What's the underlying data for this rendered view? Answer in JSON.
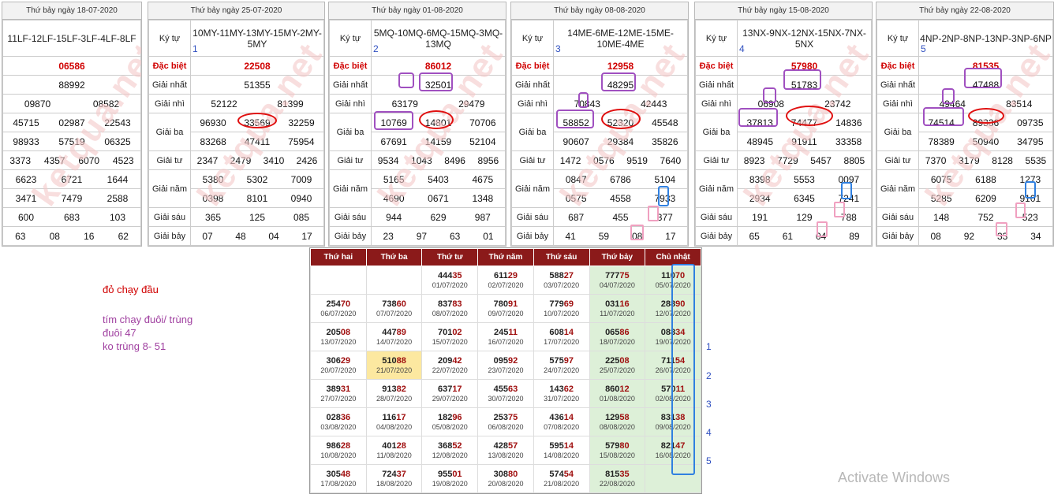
{
  "row_labels": {
    "kytu": "Ký tự",
    "db": "Đặc biệt",
    "g1": "Giải nhất",
    "g2": "Giải nhì",
    "g3": "Giải ba",
    "g4": "Giải tư",
    "g5": "Giải năm",
    "g6": "Giải sáu",
    "g7": "Giải bảy"
  },
  "watermark": "ketqua.net",
  "panels": [
    {
      "title": "Thứ bảy ngày 18-07-2020",
      "index": "",
      "kytu": "11LF-12LF-15LF-3LF-4LF-8LF",
      "db": "06586",
      "g1": "88992",
      "g2": [
        "09870",
        "08582"
      ],
      "g3": [
        "45715",
        "02987",
        "22543",
        "98933",
        "57519",
        "06325"
      ],
      "g4": [
        "3373",
        "4357",
        "6070",
        "4523"
      ],
      "g5": [
        "6623",
        "6721",
        "1644",
        "3471",
        "7479",
        "2588"
      ],
      "g6": [
        "600",
        "683",
        "103"
      ],
      "g7": [
        "63",
        "08",
        "16",
        "62"
      ]
    },
    {
      "title": "Thứ bảy ngày 25-07-2020",
      "index": "1",
      "kytu": "10MY-11MY-13MY-15MY-2MY-5MY",
      "db": "22508",
      "g1": "51355",
      "g2": [
        "52122",
        "81399"
      ],
      "g3": [
        "96930",
        "33569",
        "32259",
        "83268",
        "47411",
        "75954"
      ],
      "g4": [
        "2347",
        "2479",
        "3410",
        "2426"
      ],
      "g5": [
        "5380",
        "5302",
        "7009",
        "0398",
        "8101",
        "0940"
      ],
      "g6": [
        "365",
        "125",
        "085"
      ],
      "g7": [
        "07",
        "48",
        "04",
        "17"
      ]
    },
    {
      "title": "Thứ bảy ngày 01-08-2020",
      "index": "2",
      "kytu": "5MQ-10MQ-6MQ-15MQ-3MQ-13MQ",
      "db": "86012",
      "g1": "32501",
      "g2": [
        "63179",
        "29479"
      ],
      "g3": [
        "10769",
        "14801",
        "70706",
        "67691",
        "14159",
        "52104"
      ],
      "g4": [
        "9534",
        "1043",
        "8496",
        "8956"
      ],
      "g5": [
        "5165",
        "5403",
        "4675",
        "4690",
        "0671",
        "1348"
      ],
      "g6": [
        "944",
        "629",
        "987"
      ],
      "g7": [
        "23",
        "97",
        "63",
        "01"
      ]
    },
    {
      "title": "Thứ bảy ngày 08-08-2020",
      "index": "3",
      "kytu": "14ME-6ME-12ME-15ME-10ME-4ME",
      "db": "12958",
      "g1": "48295",
      "g2": [
        "70843",
        "42443"
      ],
      "g3": [
        "58852",
        "52320",
        "45548",
        "90607",
        "29384",
        "35826"
      ],
      "g4": [
        "1472",
        "0576",
        "9519",
        "7640"
      ],
      "g5": [
        "0847",
        "6786",
        "5104",
        "0575",
        "4558",
        "7933"
      ],
      "g6": [
        "687",
        "455",
        "377"
      ],
      "g7": [
        "41",
        "59",
        "08",
        "17"
      ]
    },
    {
      "title": "Thứ bảy ngày 15-08-2020",
      "index": "4",
      "kytu": "13NX-9NX-12NX-15NX-7NX-5NX",
      "db": "57980",
      "g1": "51783",
      "g2": [
        "06908",
        "23742"
      ],
      "g3": [
        "37813",
        "74477",
        "14836",
        "48945",
        "91911",
        "33358"
      ],
      "g4": [
        "8923",
        "7729",
        "5457",
        "8805"
      ],
      "g5": [
        "8398",
        "5553",
        "0097",
        "2934",
        "6345",
        "7241"
      ],
      "g6": [
        "191",
        "129",
        "788"
      ],
      "g7": [
        "65",
        "61",
        "04",
        "89"
      ]
    },
    {
      "title": "Thứ bảy ngày 22-08-2020",
      "index": "5",
      "kytu": "4NP-2NP-8NP-13NP-3NP-6NP",
      "db": "81535",
      "g1": "47488",
      "g2": [
        "49464",
        "83514"
      ],
      "g3": [
        "74514",
        "89336",
        "09735",
        "78389",
        "50940",
        "34795"
      ],
      "g4": [
        "7370",
        "3179",
        "8128",
        "5535"
      ],
      "g5": [
        "6075",
        "6188",
        "1273",
        "5285",
        "6209",
        "9101"
      ],
      "g6": [
        "148",
        "752",
        "523"
      ],
      "g7": [
        "08",
        "92",
        "33",
        "34"
      ]
    }
  ],
  "calendar": {
    "headers": [
      "Thứ hai",
      "Thứ ba",
      "Thứ tư",
      "Thứ năm",
      "Thứ sáu",
      "Thứ bảy",
      "Chủ nhật"
    ],
    "rows": [
      [
        {
          "n": "",
          "d": ""
        },
        {
          "n": "",
          "d": ""
        },
        {
          "n": "44435",
          "d": "01/07/2020"
        },
        {
          "n": "61129",
          "d": "02/07/2020"
        },
        {
          "n": "58827",
          "d": "03/07/2020"
        },
        {
          "n": "77775",
          "d": "04/07/2020"
        },
        {
          "n": "11070",
          "d": "05/07/2020"
        }
      ],
      [
        {
          "n": "25470",
          "d": "06/07/2020"
        },
        {
          "n": "73860",
          "d": "07/07/2020"
        },
        {
          "n": "83783",
          "d": "08/07/2020"
        },
        {
          "n": "78091",
          "d": "09/07/2020"
        },
        {
          "n": "77969",
          "d": "10/07/2020"
        },
        {
          "n": "03116",
          "d": "11/07/2020"
        },
        {
          "n": "28890",
          "d": "12/07/2020"
        }
      ],
      [
        {
          "n": "20508",
          "d": "13/07/2020"
        },
        {
          "n": "44789",
          "d": "14/07/2020"
        },
        {
          "n": "70102",
          "d": "15/07/2020"
        },
        {
          "n": "24511",
          "d": "16/07/2020"
        },
        {
          "n": "60814",
          "d": "17/07/2020"
        },
        {
          "n": "06586",
          "d": "18/07/2020"
        },
        {
          "n": "08834",
          "d": "19/07/2020"
        }
      ],
      [
        {
          "n": "30629",
          "d": "20/07/2020"
        },
        {
          "n": "51088",
          "d": "21/07/2020"
        },
        {
          "n": "20942",
          "d": "22/07/2020"
        },
        {
          "n": "09592",
          "d": "23/07/2020"
        },
        {
          "n": "57597",
          "d": "24/07/2020"
        },
        {
          "n": "22508",
          "d": "25/07/2020"
        },
        {
          "n": "71154",
          "d": "26/07/2020"
        }
      ],
      [
        {
          "n": "38931",
          "d": "27/07/2020"
        },
        {
          "n": "91382",
          "d": "28/07/2020"
        },
        {
          "n": "63717",
          "d": "29/07/2020"
        },
        {
          "n": "45563",
          "d": "30/07/2020"
        },
        {
          "n": "14362",
          "d": "31/07/2020"
        },
        {
          "n": "86012",
          "d": "01/08/2020"
        },
        {
          "n": "57011",
          "d": "02/08/2020"
        }
      ],
      [
        {
          "n": "02836",
          "d": "03/08/2020"
        },
        {
          "n": "11617",
          "d": "04/08/2020"
        },
        {
          "n": "18296",
          "d": "05/08/2020"
        },
        {
          "n": "25375",
          "d": "06/08/2020"
        },
        {
          "n": "43614",
          "d": "07/08/2020"
        },
        {
          "n": "12958",
          "d": "08/08/2020"
        },
        {
          "n": "83138",
          "d": "09/08/2020"
        }
      ],
      [
        {
          "n": "98628",
          "d": "10/08/2020"
        },
        {
          "n": "40128",
          "d": "11/08/2020"
        },
        {
          "n": "36852",
          "d": "12/08/2020"
        },
        {
          "n": "42857",
          "d": "13/08/2020"
        },
        {
          "n": "59514",
          "d": "14/08/2020"
        },
        {
          "n": "57980",
          "d": "15/08/2020"
        },
        {
          "n": "82147",
          "d": "16/08/2020"
        }
      ],
      [
        {
          "n": "30548",
          "d": "17/08/2020"
        },
        {
          "n": "72437",
          "d": "18/08/2020"
        },
        {
          "n": "95501",
          "d": "19/08/2020"
        },
        {
          "n": "30880",
          "d": "20/08/2020"
        },
        {
          "n": "57454",
          "d": "21/08/2020"
        },
        {
          "n": "81535",
          "d": "22/08/2020"
        },
        {
          "n": "",
          "d": ""
        }
      ]
    ],
    "side_numbers": [
      "1",
      "2",
      "3",
      "4",
      "5"
    ]
  },
  "notes": {
    "line1": "đỏ chạy đầu",
    "line2": "tím chạy đuôi/ trùng",
    "line3": "đuôi 47",
    "line4": "ko trùng 8- 51"
  },
  "os_watermark": "Activate Windows",
  "colors": {
    "red": "#d00000",
    "purple": "#a050c0",
    "pink": "#f0a0c0",
    "blue": "#3080e0",
    "calendar_header": "#8b1a1a",
    "weekend_green": "#ddf0d8",
    "highlight_yellow": "#fce8a0"
  }
}
